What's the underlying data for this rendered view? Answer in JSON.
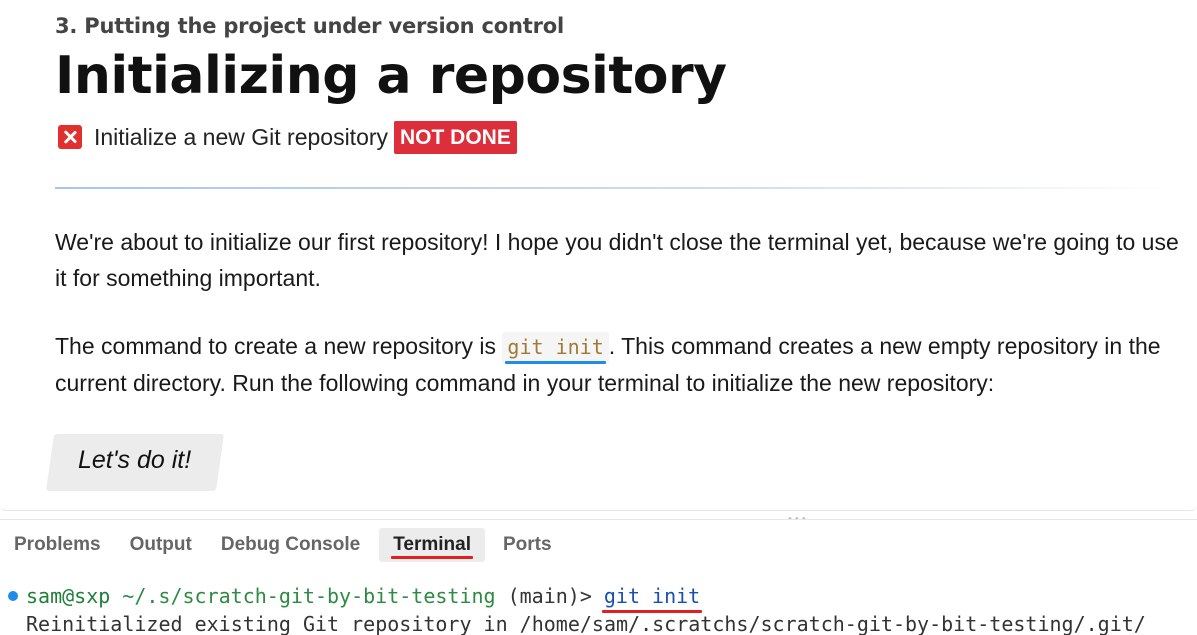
{
  "doc": {
    "chapter": "3. Putting the project under version control",
    "title": "Initializing a repository",
    "task": {
      "label": "Initialize a new Git repository",
      "status": "NOT DONE",
      "status_color": "#dc2f3b"
    },
    "para1": "We're about to initialize our first repository! I hope you didn't close the terminal yet, because we're going to use it for something important.",
    "para2_before": "The command to create a new repository is ",
    "para2_code": "git init",
    "para2_after": ". This command creates a new empty repository in the current directory. Run the following command in your terminal to initialize the new repository:",
    "cta_label": "Let's do it!"
  },
  "panel": {
    "tabs": [
      {
        "label": "Problems",
        "active": false
      },
      {
        "label": "Output",
        "active": false
      },
      {
        "label": "Debug Console",
        "active": false
      },
      {
        "label": "Terminal",
        "active": true
      },
      {
        "label": "Ports",
        "active": false
      }
    ],
    "terminal": {
      "user_host": "sam@sxp",
      "cwd": "~/.s/scratch-git-by-bit-testing",
      "branch": "(main)>",
      "command": "git init",
      "output": "Reinitialized existing Git repository in /home/sam/.scratchs/scratch-git-by-bit-testing/.git/"
    }
  },
  "colors": {
    "accent_blue": "#1f8de6",
    "highlight_red": "#e02020"
  }
}
